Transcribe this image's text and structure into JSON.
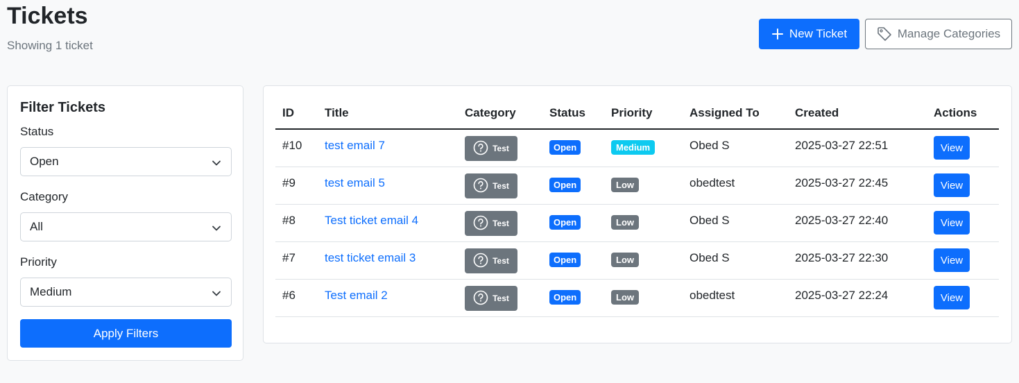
{
  "header": {
    "title": "Tickets",
    "subtitle": "Showing 1 ticket",
    "new_ticket_label": "New Ticket",
    "manage_categories_label": "Manage Categories"
  },
  "filters": {
    "title": "Filter Tickets",
    "status_label": "Status",
    "status_value": "Open",
    "category_label": "Category",
    "category_value": "All",
    "priority_label": "Priority",
    "priority_value": "Medium",
    "apply_label": "Apply Filters"
  },
  "table": {
    "columns": [
      "ID",
      "Title",
      "Category",
      "Status",
      "Priority",
      "Assigned To",
      "Created",
      "Actions"
    ],
    "rows": [
      {
        "id": "#10",
        "title": "test email 7",
        "category": "Test",
        "status": "Open",
        "priority": "Medium",
        "assigned": "Obed S",
        "created": "2025-03-27 22:51",
        "action": "View"
      },
      {
        "id": "#9",
        "title": "test email 5",
        "category": "Test",
        "status": "Open",
        "priority": "Low",
        "assigned": "obedtest",
        "created": "2025-03-27 22:45",
        "action": "View"
      },
      {
        "id": "#8",
        "title": "Test ticket email 4",
        "category": "Test",
        "status": "Open",
        "priority": "Low",
        "assigned": "Obed S",
        "created": "2025-03-27 22:40",
        "action": "View"
      },
      {
        "id": "#7",
        "title": "test ticket email 3",
        "category": "Test",
        "status": "Open",
        "priority": "Low",
        "assigned": "Obed S",
        "created": "2025-03-27 22:30",
        "action": "View"
      },
      {
        "id": "#6",
        "title": "Test email 2",
        "category": "Test",
        "status": "Open",
        "priority": "Low",
        "assigned": "obedtest",
        "created": "2025-03-27 22:24",
        "action": "View"
      }
    ]
  },
  "colors": {
    "primary": "#0d6efd",
    "secondary": "#6c757d",
    "priority_medium": "#0dcaf0",
    "priority_low": "#6c757d"
  },
  "icons": {
    "new_ticket": "plus-icon",
    "manage_categories": "tag-icon",
    "category": "question-circle-icon",
    "select": "chevron-down-icon"
  }
}
